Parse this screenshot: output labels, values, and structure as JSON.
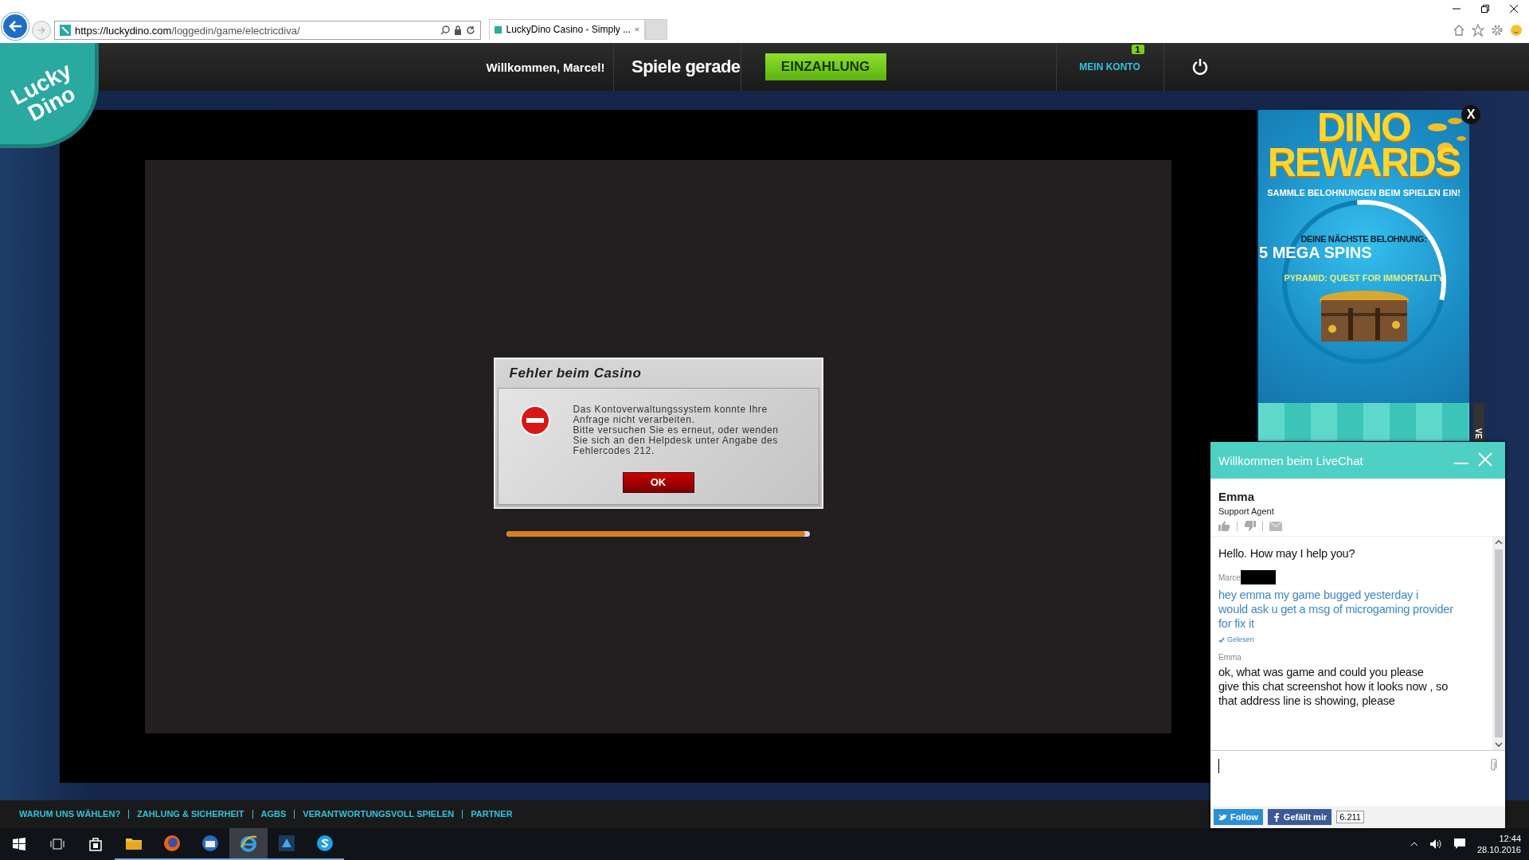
{
  "browser": {
    "url_host": "https://luckydino.com",
    "url_path": "/loggedin/game/electricdiva/",
    "tabs": [
      {
        "title": "LuckyDino Casino - Simply ...",
        "selected": true
      }
    ]
  },
  "site": {
    "logo": [
      "Lucky",
      "Dino"
    ],
    "welcome": "Willkommen, Marcel!",
    "current_game_label": "Spiele gerade",
    "deposit_button": "EINZAHLUNG",
    "account": {
      "label": "MEIN KONTO",
      "badge": "1"
    }
  },
  "error_dialog": {
    "title": "Fehler beim Casino",
    "message_lines": [
      "Das Kontoverwaltungssystem konnte Ihre",
      "Anfrage nicht verarbeiten.",
      "Bitte versuchen Sie es erneut, oder wenden",
      "Sie sich an den Helpdesk unter Angabe des",
      "Fehlercodes 212."
    ],
    "button": "OK"
  },
  "loading": {
    "level": 0.985
  },
  "rewards_ad": {
    "close": "X",
    "title_lines": [
      "DINO",
      "REWARDS"
    ],
    "subtitle": "SAMMLE BELOHNUNGEN BEIM SPIELEN EIN!",
    "next_label": "DEINE NÄCHSTE BELOHNUNG:",
    "reward": "5 MEGA SPINS",
    "game": "PYRAMID: QUEST FOR IMMORTALITY",
    "side_tab": "VE"
  },
  "chat": {
    "title": "Willkommen beim LiveChat",
    "agent": {
      "name": "Emma",
      "role": "Support Agent"
    },
    "messages": [
      {
        "kind": "agent",
        "lines": [
          "Hello. How may I help you?"
        ]
      },
      {
        "kind": "visitor",
        "sender": "Marce",
        "lines": [
          "hey emma my game bugged yesterday i",
          "would ask u get a msg of microgaming provider",
          "for fix it"
        ],
        "status": "Gelesen"
      },
      {
        "kind": "agent",
        "sender": "Emma",
        "lines": [
          "ok, what was game and could you please",
          "give this chat screenshot how it looks now , so",
          "that address line is showing, please"
        ]
      }
    ],
    "social": {
      "follow": "Follow",
      "like": "Gefällt mir",
      "like_count": "6.211"
    }
  },
  "footer_links": [
    "WARUM UNS WÄHLEN?",
    "ZAHLUNG & SICHERHEIT",
    "AGBS",
    "VERANTWORTUNGSVOLL SPIELEN",
    "PARTNER"
  ],
  "taskbar": {
    "apps": [
      {
        "kind": "explorer",
        "selected": false
      },
      {
        "kind": "firefox",
        "selected": false
      },
      {
        "kind": "mail",
        "selected": false
      },
      {
        "kind": "ie",
        "selected": true
      },
      {
        "kind": "app",
        "selected": false
      },
      {
        "kind": "skype",
        "selected": false
      }
    ],
    "time": "12:44",
    "date": "28.10.2016"
  }
}
